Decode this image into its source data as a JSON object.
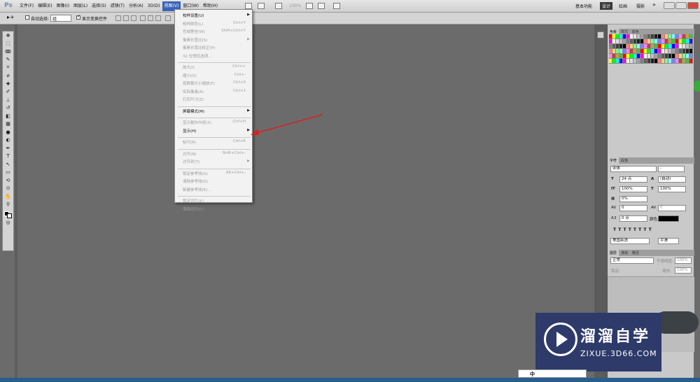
{
  "app": {
    "logo": "Ps"
  },
  "menubar": {
    "menus": [
      "文件(F)",
      "编辑(E)",
      "图像(I)",
      "图层(L)",
      "选择(S)",
      "滤镜(T)",
      "分析(A)",
      "3D(D)",
      "视图(V)",
      "窗口(W)",
      "帮助(H)"
    ],
    "active_menu": "视图(V)",
    "zoom": "100%",
    "workspaces": [
      "基本功能",
      "设计",
      "绘画",
      "摄影"
    ],
    "selected_workspace": "设计",
    "more": "»"
  },
  "options_bar": {
    "auto_select_label": "自动选择:",
    "auto_select_value": "组",
    "show_transform_label": "显示变换控件"
  },
  "view_menu": {
    "items": [
      {
        "label": "校样设置(U)",
        "shortcut": "",
        "submenu": true,
        "enabled": true
      },
      {
        "label": "校样颜色(L)",
        "shortcut": "Ctrl+Y",
        "submenu": false,
        "enabled": false
      },
      {
        "label": "色域警告(W)",
        "shortcut": "Shift+Ctrl+Y",
        "submenu": false,
        "enabled": false
      },
      {
        "label": "像素长宽比(S)",
        "shortcut": "",
        "submenu": true,
        "enabled": false
      },
      {
        "label": "像素长宽比校正(P)",
        "shortcut": "",
        "submenu": false,
        "enabled": false
      },
      {
        "label": "32 位预览选项...",
        "shortcut": "",
        "submenu": false,
        "enabled": false
      },
      {
        "label": "放大(I)",
        "shortcut": "Ctrl++",
        "submenu": false,
        "enabled": false,
        "sep_before": true
      },
      {
        "label": "缩小(O)",
        "shortcut": "Ctrl+-",
        "submenu": false,
        "enabled": false
      },
      {
        "label": "按屏幕大小缩放(F)",
        "shortcut": "Ctrl+0",
        "submenu": false,
        "enabled": false
      },
      {
        "label": "实际像素(A)",
        "shortcut": "Ctrl+1",
        "submenu": false,
        "enabled": false
      },
      {
        "label": "打印尺寸(Z)",
        "shortcut": "",
        "submenu": false,
        "enabled": false
      },
      {
        "label": "屏幕模式(M)",
        "shortcut": "",
        "submenu": true,
        "enabled": true,
        "sep_before": true
      },
      {
        "label": "显示额外内容(X)",
        "shortcut": "Ctrl+H",
        "submenu": false,
        "enabled": false,
        "sep_before": true
      },
      {
        "label": "显示(H)",
        "shortcut": "",
        "submenu": true,
        "enabled": true
      },
      {
        "label": "标尺(R)",
        "shortcut": "Ctrl+R",
        "submenu": false,
        "enabled": false,
        "sep_before": true
      },
      {
        "label": "对齐(N)",
        "shortcut": "Shift+Ctrl+;",
        "submenu": false,
        "enabled": false,
        "sep_before": true
      },
      {
        "label": "对齐到(T)",
        "shortcut": "",
        "submenu": true,
        "enabled": false
      },
      {
        "label": "锁定参考线(G)",
        "shortcut": "Alt+Ctrl+;",
        "submenu": false,
        "enabled": false,
        "sep_before": true
      },
      {
        "label": "清除参考线(D)",
        "shortcut": "",
        "submenu": false,
        "enabled": false
      },
      {
        "label": "新建参考线(E)...",
        "shortcut": "",
        "submenu": false,
        "enabled": false
      },
      {
        "label": "锁定切片(K)",
        "shortcut": "",
        "submenu": false,
        "enabled": false,
        "sep_before": true
      },
      {
        "label": "清除切片(C)",
        "shortcut": "",
        "submenu": false,
        "enabled": false
      }
    ]
  },
  "panels": {
    "swatch_tabs": [
      "色板",
      "样式",
      "颜色"
    ],
    "char_tabs": [
      "字符",
      "段落"
    ],
    "font_family": "宋体",
    "font_style": "-",
    "font_size": "24 点",
    "leading": "(自动)",
    "vert_scale": "100%",
    "horiz_scale": "100%",
    "tsume": "0%",
    "kerning": "0",
    "tracking": "0",
    "baseline": "0 点",
    "color_label": "颜色:",
    "language": "美国英语",
    "antialias": "平滑",
    "layer_tabs": [
      "图层",
      "通道",
      "路径"
    ],
    "blend_mode": "正常",
    "opacity_label": "不透明度:",
    "opacity": "100%",
    "fill_label": "填充:",
    "fill": "100%",
    "lock_label": "锁定:"
  },
  "watermark": {
    "cn": "溜溜自学",
    "en": "ZIXUE.3D66.COM"
  },
  "ime": {
    "label": "中"
  },
  "colors": {
    "menu_active": "#3a63b5",
    "workspace_bg": "#6b6b6b",
    "watermark_bg": "#2d3a6a",
    "arrow": "#d92020"
  }
}
